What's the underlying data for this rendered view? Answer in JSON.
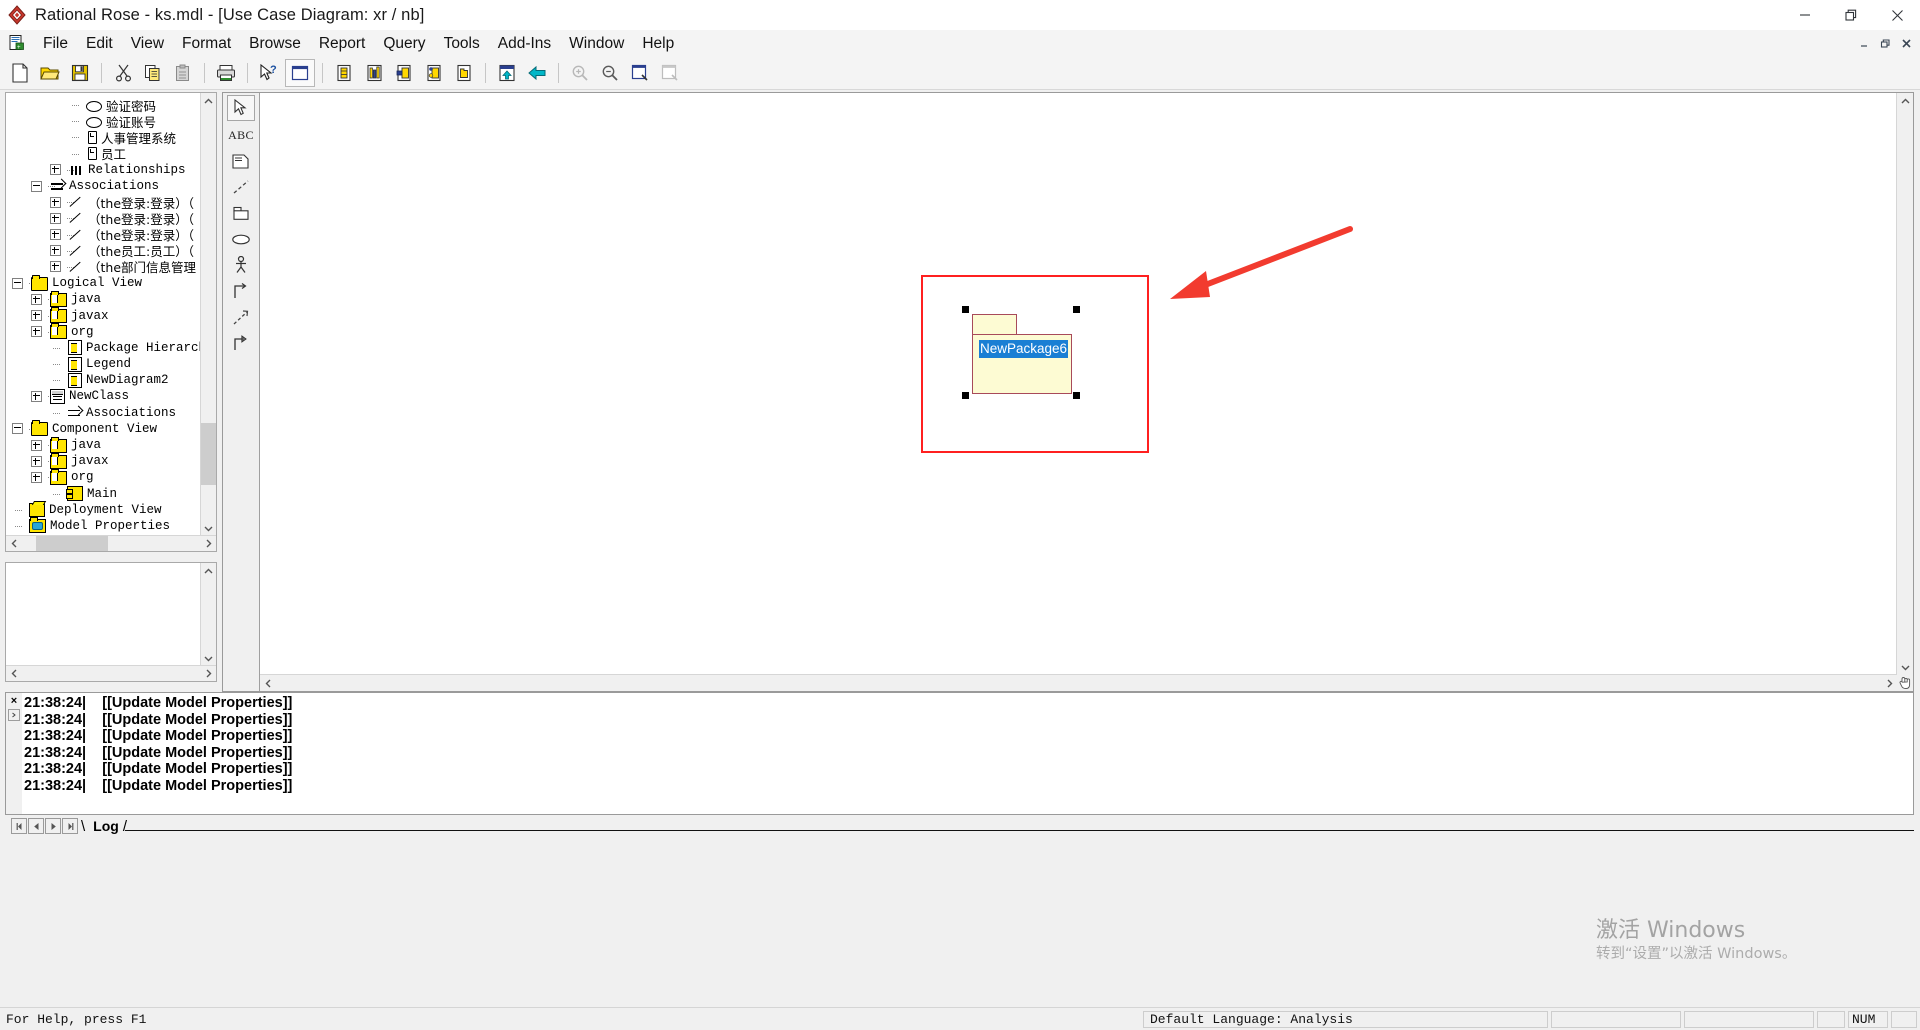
{
  "window": {
    "title": "Rational Rose - ks.mdl - [Use Case Diagram: xr / nb]",
    "app_icon": "rational-rose-icon",
    "minimize": "—",
    "maximize": "❐",
    "close": "✕"
  },
  "mdi": {
    "minimize": "–",
    "restore": "❐",
    "close": "✕"
  },
  "menubar": {
    "doc_icon": "model-icon",
    "items": [
      {
        "label": "File"
      },
      {
        "label": "Edit"
      },
      {
        "label": "View"
      },
      {
        "label": "Format"
      },
      {
        "label": "Browse"
      },
      {
        "label": "Report"
      },
      {
        "label": "Query"
      },
      {
        "label": "Tools"
      },
      {
        "label": "Add-Ins"
      },
      {
        "label": "Window"
      },
      {
        "label": "Help"
      }
    ]
  },
  "toolbar": {
    "buttons": [
      {
        "name": "new-model-icon",
        "title": "New"
      },
      {
        "name": "open-model-icon",
        "title": "Open"
      },
      {
        "name": "save-model-icon",
        "title": "Save"
      },
      {
        "name": "cut-icon",
        "title": "Cut"
      },
      {
        "name": "copy-icon",
        "title": "Copy"
      },
      {
        "name": "paste-icon",
        "title": "Paste"
      },
      {
        "name": "print-icon",
        "title": "Print"
      },
      {
        "name": "context-help-icon",
        "title": "Context Sensitive Help"
      },
      {
        "name": "browser-toggle-icon",
        "title": "View Browser"
      },
      {
        "name": "documentation-icon",
        "title": "View Documentation"
      },
      {
        "name": "diagram-toolbar-icon",
        "title": "View Diagram Toolbar"
      },
      {
        "name": "log-icon",
        "title": "View Log"
      },
      {
        "name": "units-icon",
        "title": "View Units"
      },
      {
        "name": "package-icon",
        "title": "View Package"
      },
      {
        "name": "browse-parent-icon",
        "title": "Browse Parent"
      },
      {
        "name": "back-arrow-icon",
        "title": "Browse Previous Diagram"
      },
      {
        "name": "zoom-in-icon",
        "title": "Zoom In"
      },
      {
        "name": "zoom-out-icon",
        "title": "Zoom Out"
      },
      {
        "name": "fit-in-window-icon",
        "title": "Fit In Window"
      },
      {
        "name": "undo-fit-icon",
        "title": "Undo Fit In Window"
      }
    ]
  },
  "browser": {
    "tree": [
      {
        "indent": 3,
        "toggle": "none",
        "icon": "usecase-icon",
        "label": "验证密码",
        "cn": true
      },
      {
        "indent": 3,
        "toggle": "none",
        "icon": "usecase-icon",
        "label": "验证账号",
        "cn": true
      },
      {
        "indent": 3,
        "toggle": "none",
        "icon": "actor-icon",
        "label": "人事管理系统",
        "cn": true
      },
      {
        "indent": 3,
        "toggle": "none",
        "icon": "actor-icon",
        "label": "员工",
        "cn": true
      },
      {
        "indent": 2,
        "toggle": "plus",
        "icon": "relationships-icon",
        "label": "Relationships",
        "cn": false
      },
      {
        "indent": 1,
        "toggle": "minus",
        "icon": "associations-icon",
        "label": "Associations",
        "cn": false
      },
      {
        "indent": 2,
        "toggle": "plus",
        "icon": "association-line-icon",
        "label": "（the登录:登录）（",
        "cn": true
      },
      {
        "indent": 2,
        "toggle": "plus",
        "icon": "association-line-icon",
        "label": "（the登录:登录）（",
        "cn": true
      },
      {
        "indent": 2,
        "toggle": "plus",
        "icon": "association-line-icon",
        "label": "（the登录:登录）（",
        "cn": true
      },
      {
        "indent": 2,
        "toggle": "plus",
        "icon": "association-line-icon",
        "label": "（the员工:员工）（",
        "cn": true
      },
      {
        "indent": 2,
        "toggle": "plus",
        "icon": "association-line-icon",
        "label": "（the部门信息管理",
        "cn": true
      },
      {
        "indent": 0,
        "toggle": "minus",
        "icon": "folder-icon",
        "label": "Logical View",
        "cn": false
      },
      {
        "indent": 1,
        "toggle": "plus",
        "icon": "package-icon",
        "label": "java",
        "cn": false
      },
      {
        "indent": 1,
        "toggle": "plus",
        "icon": "package-icon",
        "label": "javax",
        "cn": false
      },
      {
        "indent": 1,
        "toggle": "plus",
        "icon": "package-icon",
        "label": "org",
        "cn": false
      },
      {
        "indent": 2,
        "toggle": "none",
        "icon": "diagram-icon",
        "label": "Package Hierarchy",
        "cn": false
      },
      {
        "indent": 2,
        "toggle": "none",
        "icon": "diagram-icon",
        "label": "Legend",
        "cn": false
      },
      {
        "indent": 2,
        "toggle": "none",
        "icon": "diagram-icon",
        "label": "NewDiagram2",
        "cn": false
      },
      {
        "indent": 1,
        "toggle": "plus",
        "icon": "class-icon",
        "label": "NewClass",
        "cn": false
      },
      {
        "indent": 2,
        "toggle": "none",
        "icon": "associations-icon",
        "label": "Associations",
        "cn": false
      },
      {
        "indent": 0,
        "toggle": "minus",
        "icon": "folder-icon",
        "label": "Component View",
        "cn": false
      },
      {
        "indent": 1,
        "toggle": "plus",
        "icon": "package-icon",
        "label": "java",
        "cn": false
      },
      {
        "indent": 1,
        "toggle": "plus",
        "icon": "package-icon",
        "label": "javax",
        "cn": false
      },
      {
        "indent": 1,
        "toggle": "plus",
        "icon": "package-icon",
        "label": "org",
        "cn": false
      },
      {
        "indent": 2,
        "toggle": "none",
        "icon": "component-icon",
        "label": "Main",
        "cn": false
      },
      {
        "indent": 0,
        "toggle": "none",
        "icon": "deployment-icon",
        "label": "Deployment View",
        "cn": false
      },
      {
        "indent": 0,
        "toggle": "none",
        "icon": "model-properties-icon",
        "label": "Model Properties",
        "cn": false
      }
    ],
    "scroll_up_icon": "chevron-up-icon",
    "scroll_down_icon": "chevron-down-icon",
    "scroll_left_icon": "chevron-left-icon",
    "scroll_right_icon": "chevron-right-icon"
  },
  "toolbox": {
    "tools": [
      {
        "name": "selector-tool",
        "icon": "arrow-cursor-icon",
        "selected": true
      },
      {
        "name": "text-tool",
        "icon": "abc-text-icon",
        "label": "ABC",
        "selected": false
      },
      {
        "name": "note-tool",
        "icon": "note-icon",
        "selected": false
      },
      {
        "name": "anchor-note-tool",
        "icon": "dashed-line-icon",
        "selected": false
      },
      {
        "name": "package-tool",
        "icon": "package-shape-icon",
        "selected": false
      },
      {
        "name": "usecase-tool",
        "icon": "ellipse-icon",
        "selected": false
      },
      {
        "name": "actor-tool",
        "icon": "stick-figure-icon",
        "selected": false
      },
      {
        "name": "unidirectional-association-tool",
        "icon": "corner-arrow-icon",
        "selected": false
      },
      {
        "name": "dependency-tool",
        "icon": "dashed-arrow-icon",
        "selected": false
      },
      {
        "name": "generalization-tool",
        "icon": "generalization-arrow-icon",
        "selected": false
      }
    ]
  },
  "diagram": {
    "package": {
      "name": "NewPackage6",
      "fill_color": "#fdfbd3",
      "border_color": "#a84a5a",
      "label_highlight_color": "#1a7fd4",
      "selected": true,
      "handle_count": 4
    },
    "annotation": {
      "rect_color": "#ff2020",
      "arrow_color": "#f23b2f",
      "arrow_name": "red-pointer-arrow"
    }
  },
  "log": {
    "close_icon": "x-icon",
    "expand_icon": "expand-icon",
    "lines": [
      {
        "time": "21:38:24|",
        "message": "[[Update Model Properties]]"
      },
      {
        "time": "21:38:24|",
        "message": "[[Update Model Properties]]"
      },
      {
        "time": "21:38:24|",
        "message": "[[Update Model Properties]]"
      },
      {
        "time": "21:38:24|",
        "message": "[[Update Model Properties]]"
      },
      {
        "time": "21:38:24|",
        "message": "[[Update Model Properties]]"
      },
      {
        "time": "21:38:24|",
        "message": "[[Update Model Properties]]"
      }
    ],
    "tab_label": "Log",
    "nav": [
      {
        "name": "first-record-button",
        "glyph": "◀│"
      },
      {
        "name": "prev-record-button",
        "glyph": "◀"
      },
      {
        "name": "next-record-button",
        "glyph": "▶"
      },
      {
        "name": "last-record-button",
        "glyph": "│▶"
      }
    ]
  },
  "statusbar": {
    "help_text": "For Help, press F1",
    "language": "Default Language: Analysis",
    "cell2": "",
    "cell3": "",
    "cell4": "",
    "num_lock": "NUM",
    "cell6": ""
  },
  "watermark": {
    "line1": "激活 Windows",
    "line2": "转到“设置”以激活 Windows。"
  }
}
